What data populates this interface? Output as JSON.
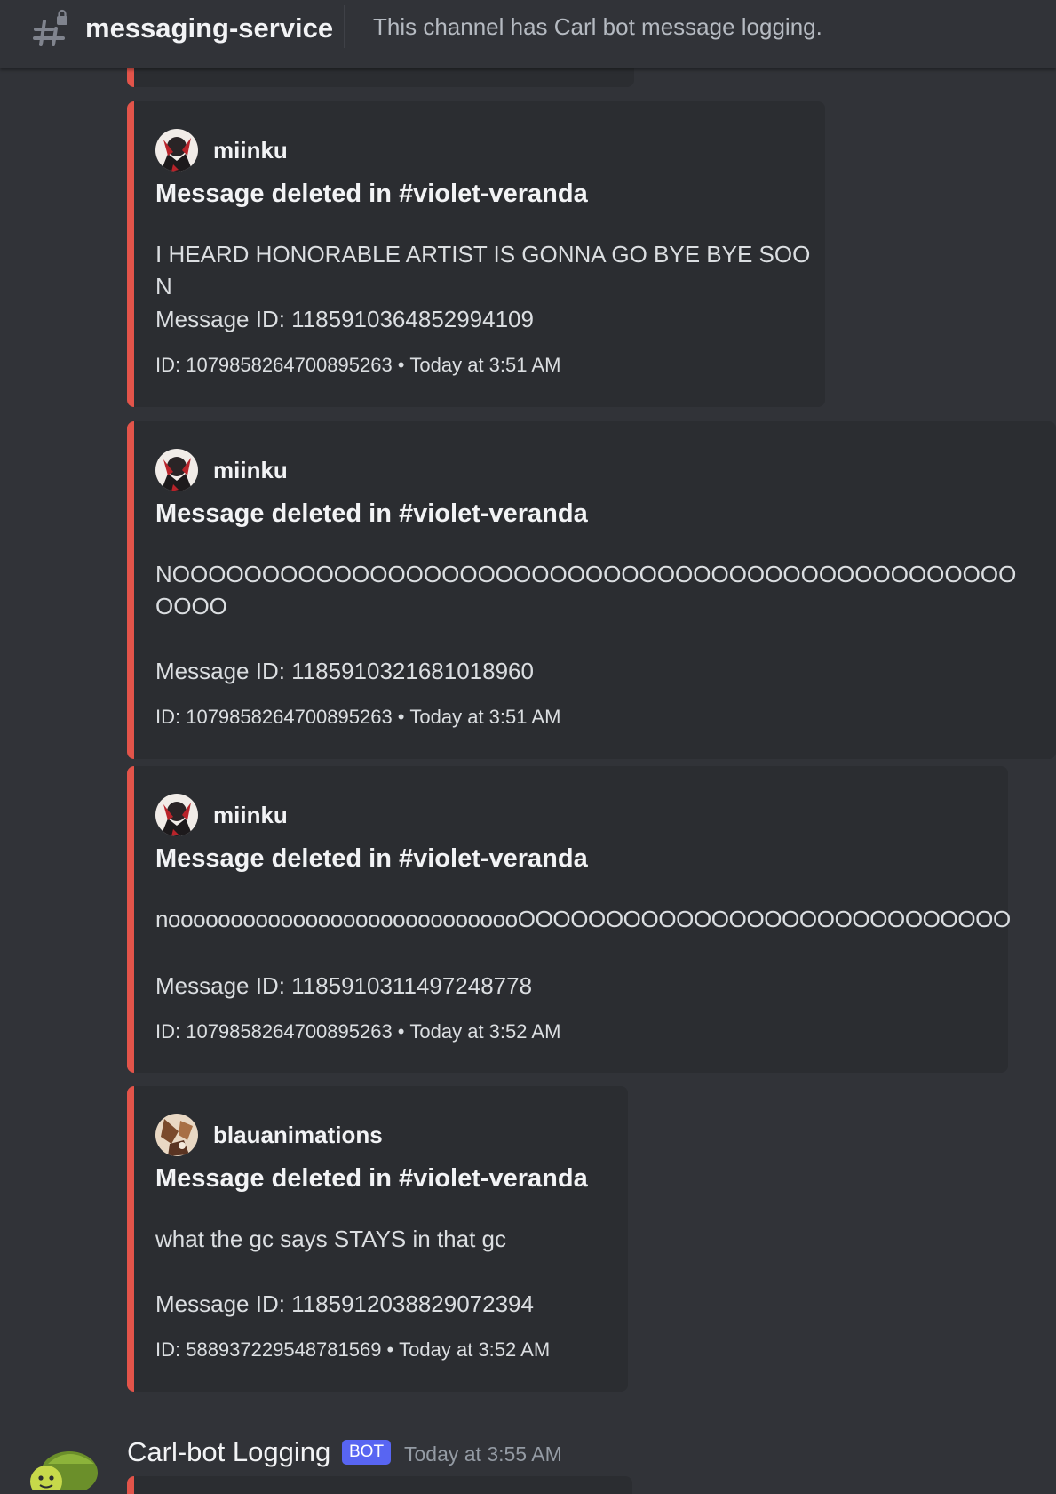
{
  "header": {
    "channel_name": "messaging-service",
    "topic": "This channel has Carl bot message logging."
  },
  "embeds": [
    {
      "author": "miinku",
      "title": "Message deleted in #violet-veranda",
      "description": "I HEARD HONORABLE ARTIST IS GONNA GO BYE BYE SOON",
      "message_id": "Message ID: 1185910364852994109",
      "user_id": "ID: 1079858264700895263",
      "timestamp": "Today at 3:51 AM"
    },
    {
      "author": "miinku",
      "title": "Message deleted in #violet-veranda",
      "description": "NOOOOOOOOOOOOOOOOOOOOOOOOOOOOOOOOOOOOOOOOOOOOOOOOOOO",
      "message_id": "Message ID: 1185910321681018960",
      "user_id": "ID: 1079858264700895263",
      "timestamp": "Today at 3:51 AM"
    },
    {
      "author": "miinku",
      "title": "Message deleted in #violet-veranda",
      "description": "nooooooooooooooooooooooooooooOOOOOOOOOOOOOOOOOOOOOOOOOOOO",
      "message_id": "Message ID: 1185910311497248778",
      "user_id": "ID: 1079858264700895263",
      "timestamp": "Today at 3:52 AM"
    },
    {
      "author": "blauanimations",
      "title": "Message deleted in #violet-veranda",
      "description": "what the gc says STAYS in that gc",
      "message_id": "Message ID: 1185912038829072394",
      "user_id": "ID: 588937229548781569",
      "timestamp": "Today at 3:52 AM"
    }
  ],
  "footer_separator": "•",
  "bot_message": {
    "author": "Carl-bot Logging",
    "tag": "BOT",
    "timestamp": "Today at 3:55 AM"
  },
  "colors": {
    "background": "#313338",
    "embed_background": "#2b2d31",
    "embed_accent": "#e2544a",
    "bot_tag": "#5865f2"
  },
  "icons": {
    "channel": "locked-text-channel-icon",
    "bot_avatar": "turtle-avatar-icon"
  }
}
